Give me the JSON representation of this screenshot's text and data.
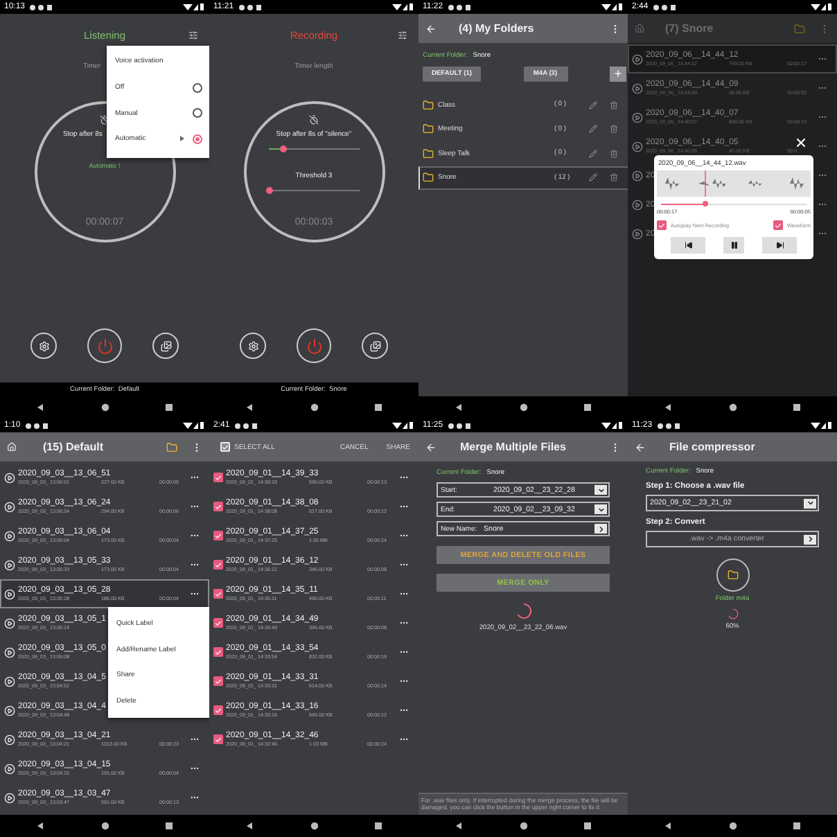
{
  "screens": [
    {
      "kind": "recorder",
      "status_time": "10:13",
      "recording": false,
      "title": "Listening",
      "timer_label": "Timer",
      "stop_label": "Stop after 8s",
      "status_text": "Automatic !",
      "time": "00:00:07",
      "footer": "Current Folder:  Default",
      "menu": {
        "title": "Voice activation",
        "options": [
          {
            "label": "Off",
            "selected": false
          },
          {
            "label": "Manual",
            "selected": false
          },
          {
            "label": "Automatic",
            "selected": true
          }
        ]
      }
    },
    {
      "kind": "recorder",
      "status_time": "11:21",
      "recording": true,
      "title": "Recording",
      "timer_label": "Timer length",
      "stop_label": "Stop after 8s of \"silence\"",
      "silence_slider": {
        "level": 0.17
      },
      "threshold_label": "Threshold 3",
      "threshold_slider": {
        "level": 0.02
      },
      "time": "00:00:03",
      "footer": "Current Folder:  Snore"
    },
    {
      "kind": "folders",
      "status_time": "11:22",
      "title": "(4) My Folders",
      "current_label": "Current Folder:",
      "current_folder": "Snore",
      "buttons": [
        "DEFAULT (1)",
        "M4A (3)"
      ],
      "add": "+",
      "folders": [
        {
          "name": "Class",
          "count": "( 0 )",
          "selected": false
        },
        {
          "name": "Meeting",
          "count": "( 0 )",
          "selected": false
        },
        {
          "name": "Sleep Talk",
          "count": "( 0 )",
          "selected": false
        },
        {
          "name": "Snore",
          "count": "( 12 )",
          "selected": true
        }
      ]
    },
    {
      "kind": "player",
      "status_time": "2:44",
      "title": "(7) Snore",
      "rows": [
        {
          "name": "2020_09_06__14_44_12",
          "date": "2020_09_06_ 14:44:12",
          "size": "759.00 KB",
          "duration": "00:00:17",
          "selected": true
        },
        {
          "name": "2020_09_06__14_44_09",
          "date": "2020_09_06_ 14:44:09",
          "size": "96.00 KB",
          "duration": "00:00:02",
          "selected": false
        },
        {
          "name": "2020_09_06__14_40_07",
          "date": "2020_09_06_ 14:40:07",
          "size": "800.00 KB",
          "duration": "00:00:19",
          "selected": false
        },
        {
          "name": "2020_09_06__14_40_05",
          "date": "2020_09_06_ 14:40:05",
          "size": "45.00 KB",
          "duration": "00:0",
          "selected": false
        },
        {
          "name": "20",
          "selected": false
        },
        {
          "name": "20",
          "selected": false
        },
        {
          "name": "20",
          "selected": false
        }
      ],
      "player": {
        "file": "2020_09_06__14_44_12.wav",
        "level": 0.3,
        "position": "00:00:17",
        "length": "00:00:05",
        "options": [
          {
            "label": "Autoplay Next Recording",
            "checked": true
          },
          {
            "label": "Waveform",
            "checked": true
          }
        ]
      }
    },
    {
      "kind": "list",
      "status_time": "1:10",
      "title": "(15) Default",
      "rows": [
        {
          "name": "2020_09_03__13_06_51",
          "date": "2020_09_03_ 13:06:51",
          "size": "227.00 KB",
          "duration": "00:00:05",
          "selected": false
        },
        {
          "name": "2020_09_03__13_06_24",
          "date": "2020_09_03_ 13:06:24",
          "size": "294.00 KB",
          "duration": "00:00:06",
          "selected": false
        },
        {
          "name": "2020_09_03__13_06_04",
          "date": "2020_09_03_ 13:06:04",
          "size": "173.00 KB",
          "duration": "00:00:04",
          "selected": false
        },
        {
          "name": "2020_09_03__13_05_33",
          "date": "2020_09_03_ 13:05:33",
          "size": "173.00 KB",
          "duration": "00:00:04",
          "selected": false
        },
        {
          "name": "2020_09_03__13_05_28",
          "date": "2020_09_03_ 13:05:28",
          "size": "186.00 KB",
          "duration": "00:00:04",
          "selected": true
        },
        {
          "name": "2020_09_03__13_05_1",
          "date": "2020_09_03_ 13:05:14",
          "selected": false
        },
        {
          "name": "2020_09_03__13_05_0",
          "date": "2020_09_03_ 13:05:08",
          "selected": false
        },
        {
          "name": "2020_09_03__13_04_5",
          "date": "2020_09_03_ 13:04:52",
          "selected": false
        },
        {
          "name": "2020_09_03__13_04_4",
          "date": "2020_09_03_ 13:04:48",
          "selected": false
        },
        {
          "name": "2020_09_03__13_04_21",
          "date": "2020_09_03_ 13:04:21",
          "size": "1013.00 KB",
          "duration": "00:00:23",
          "selected": false
        },
        {
          "name": "2020_09_03__13_04_15",
          "date": "2020_09_03_ 13:04:15",
          "size": "191.00 KB",
          "duration": "00:00:04",
          "selected": false
        },
        {
          "name": "2020_09_03__13_03_47",
          "date": "2020_09_03_ 13:03:47",
          "size": "561.00 KB",
          "duration": "00:00:13",
          "selected": false
        }
      ],
      "menu": [
        "Quick Label",
        "Add/Rename Label",
        "Share",
        "Delete"
      ]
    },
    {
      "kind": "select",
      "status_time": "2:41",
      "select_all": {
        "label": "SELECT ALL",
        "checked": true
      },
      "actions": [
        "CANCEL",
        "SHARE"
      ],
      "rows": [
        {
          "name": "2020_09_01__14_39_33",
          "date": "2020_09_01_ 14:39:33",
          "size": "590.00 KB",
          "duration": "00:00:13",
          "checked": true
        },
        {
          "name": "2020_09_01__14_38_08",
          "date": "2020_09_01_ 14:38:08",
          "size": "517.00 KB",
          "duration": "00:00:12",
          "checked": true
        },
        {
          "name": "2020_09_01__14_37_25",
          "date": "2020_09_01_ 14:37:25",
          "size": "1.05 MB",
          "duration": "00:00:24",
          "checked": true
        },
        {
          "name": "2020_09_01__14_36_12",
          "date": "2020_09_01_ 14:36:12",
          "size": "346.00 KB",
          "duration": "00:00:08",
          "checked": true
        },
        {
          "name": "2020_09_01__14_35_11",
          "date": "2020_09_01_ 14:35:11",
          "size": "490.00 KB",
          "duration": "00:00:11",
          "checked": true
        },
        {
          "name": "2020_09_01__14_34_49",
          "date": "2020_09_01_ 14:34:49",
          "size": "346.00 KB",
          "duration": "00:00:08",
          "checked": true
        },
        {
          "name": "2020_09_01__14_33_54",
          "date": "2020_09_01_ 14:33:54",
          "size": "832.00 KB",
          "duration": "00:00:19",
          "checked": true
        },
        {
          "name": "2020_09_01__14_33_31",
          "date": "2020_09_01_ 14:33:31",
          "size": "614.00 KB",
          "duration": "00:00:14",
          "checked": true
        },
        {
          "name": "2020_09_01__14_33_16",
          "date": "2020_09_01_ 14:33:16",
          "size": "546.00 KB",
          "duration": "00:00:12",
          "checked": true
        },
        {
          "name": "2020_09_01__14_32_46",
          "date": "2020_09_01_ 14:32:46",
          "size": "1.03 MB",
          "duration": "00:00:24",
          "checked": true
        }
      ]
    },
    {
      "kind": "merge",
      "status_time": "11:25",
      "title": "Merge Multiple Files",
      "current_label": "Current Folder:",
      "current_folder": "Snore",
      "fields": [
        {
          "label": "Start:",
          "value": "2020_09_02__23_22_28",
          "kind": "dropdown"
        },
        {
          "label": "End:",
          "value": "2020_09_02__23_09_32",
          "kind": "dropdown"
        },
        {
          "label": "New Name:",
          "value": "Snore",
          "kind": "next"
        }
      ],
      "buttons": [
        {
          "label": "MERGE AND DELETE OLD FILES",
          "kind": "delete"
        },
        {
          "label": "MERGE ONLY",
          "kind": "keep"
        }
      ],
      "file": "2020_09_02__23_22_06.wav",
      "note": "For .wav files only. If interrupted during the merge process, the file will be damaged, you can click the button in the upper right corner to fix it."
    },
    {
      "kind": "compressor",
      "status_time": "11:23",
      "title": "File compressor",
      "current_label": "Current Folder:",
      "current_folder": "Snore",
      "step1": "Step 1: Choose a .wav file",
      "file": "2020_09_02__23_21_02",
      "step2": "Step 2: Convert",
      "converter": ".wav -> .m4a converter",
      "folder_label": "Folder m4a",
      "progress": "60%"
    }
  ]
}
